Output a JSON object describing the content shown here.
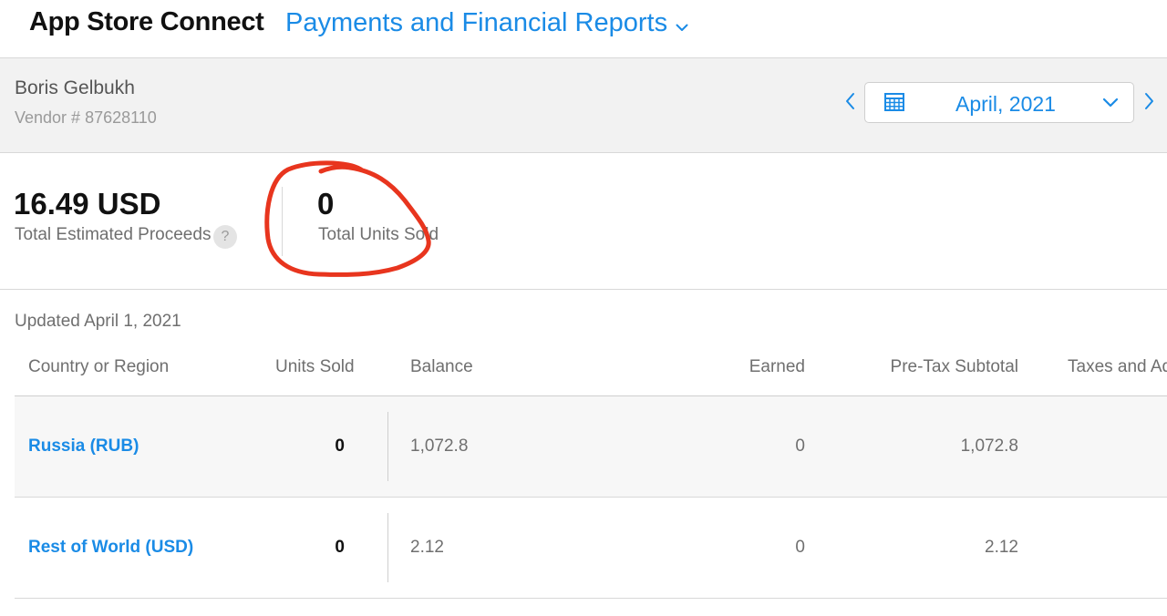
{
  "header": {
    "app_title": "App Store Connect",
    "section_title": "Payments and Financial Reports"
  },
  "vendor": {
    "name": "Boris Gelbukh",
    "number": "Vendor # 87628110"
  },
  "period_picker": {
    "value": "April, 2021",
    "prev_icon": "chevron-left-icon",
    "next_icon": "chevron-right-icon",
    "calendar_icon": "calendar-icon",
    "dropdown_icon": "chevron-down-icon"
  },
  "stats": {
    "proceeds_value": "16.49 USD",
    "proceeds_label": "Total Estimated Proceeds",
    "help_glyph": "?",
    "units_value": "0",
    "units_label": "Total Units Sold"
  },
  "table": {
    "updated": "Updated April 1, 2021",
    "columns": [
      "Country or Region",
      "Units Sold",
      "Balance",
      "Earned",
      "Pre-Tax Subtotal",
      "Taxes and Adj"
    ],
    "rows": [
      {
        "country": "Russia (RUB)",
        "units": "0",
        "balance": "1,072.8",
        "earned": "0",
        "pretax": "1,072.8"
      },
      {
        "country": "Rest of World (USD)",
        "units": "0",
        "balance": "2.12",
        "earned": "0",
        "pretax": "2.12"
      }
    ]
  },
  "colors": {
    "accent": "#1a8be6",
    "annotation": "#e8351e",
    "band_bg": "#f2f2f2"
  }
}
